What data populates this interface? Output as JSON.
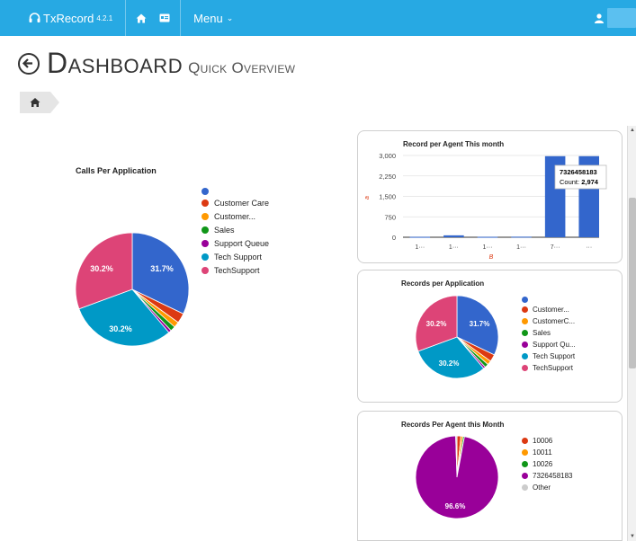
{
  "navbar": {
    "brand": "TxRecord",
    "version": "4.2.1",
    "menu_label": "Menu",
    "icons": [
      "headset-icon",
      "home-icon",
      "id-card-icon",
      "user-icon"
    ]
  },
  "page": {
    "title": "Dashboard",
    "subtitle": "Quick Overview"
  },
  "calls_per_application": {
    "title": "Calls Per Application",
    "legend": [
      {
        "label": "",
        "color": "#3366cc"
      },
      {
        "label": "Customer Care",
        "color": "#dc3912"
      },
      {
        "label": "Customer...",
        "color": "#ff9900"
      },
      {
        "label": "Sales",
        "color": "#109618"
      },
      {
        "label": "Support Queue",
        "color": "#990099"
      },
      {
        "label": "Tech Support",
        "color": "#0099c6"
      },
      {
        "label": "TechSupport",
        "color": "#dd4477"
      }
    ],
    "slice_labels": [
      "31.7%",
      "30.2%",
      "30.2%"
    ]
  },
  "record_per_agent": {
    "title": "Record per Agent This month",
    "y_ticks": [
      "0",
      "750",
      "1,500",
      "2,250",
      "3,000"
    ],
    "x_ticks": [
      "1···",
      "1···",
      "1···",
      "1···",
      "7···",
      "···"
    ],
    "y_axis_label": "a",
    "x_axis_label": "B",
    "tooltip_title": "7326458183",
    "tooltip_count_label": "Count:",
    "tooltip_count_value": "2,974"
  },
  "records_per_application": {
    "title": "Records per Application",
    "legend": [
      {
        "label": "",
        "color": "#3366cc"
      },
      {
        "label": "Customer...",
        "color": "#dc3912"
      },
      {
        "label": "CustomerC...",
        "color": "#ff9900"
      },
      {
        "label": "Sales",
        "color": "#109618"
      },
      {
        "label": "Support Qu...",
        "color": "#990099"
      },
      {
        "label": "Tech Support",
        "color": "#0099c6"
      },
      {
        "label": "TechSupport",
        "color": "#dd4477"
      }
    ],
    "slice_labels": [
      "31.7%",
      "30.2%",
      "30.2%"
    ]
  },
  "records_per_agent_month": {
    "title": "Records Per Agent this Month",
    "legend": [
      {
        "label": "10006",
        "color": "#dc3912"
      },
      {
        "label": "10011",
        "color": "#ff9900"
      },
      {
        "label": "10026",
        "color": "#109618"
      },
      {
        "label": "7326458183",
        "color": "#990099"
      },
      {
        "label": "Other",
        "color": "#cccccc"
      }
    ],
    "slice_labels": [
      "96.6%"
    ]
  },
  "chart_data": [
    {
      "type": "pie",
      "title": "Calls Per Application",
      "categories": [
        "",
        "Customer Care",
        "Customer...",
        "Sales",
        "Support Queue",
        "Tech Support",
        "TechSupport"
      ],
      "values": [
        31.7,
        2.8,
        1.6,
        1.4,
        0.8,
        30.2,
        30.2
      ],
      "colors": [
        "#3366cc",
        "#dc3912",
        "#ff9900",
        "#109618",
        "#990099",
        "#0099c6",
        "#dd4477"
      ]
    },
    {
      "type": "bar",
      "title": "Record per Agent This month",
      "categories": [
        "1···",
        "1···",
        "1···",
        "1···",
        "7···",
        "···"
      ],
      "values": [
        15,
        70,
        15,
        20,
        2974,
        2974
      ],
      "ylim": [
        0,
        3000
      ],
      "xlabel": "B",
      "ylabel": "a"
    },
    {
      "type": "pie",
      "title": "Records per Application",
      "categories": [
        "",
        "Customer...",
        "CustomerC...",
        "Sales",
        "Support Qu...",
        "Tech Support",
        "TechSupport"
      ],
      "values": [
        31.7,
        2.8,
        1.6,
        1.4,
        0.8,
        30.2,
        30.2
      ],
      "colors": [
        "#3366cc",
        "#dc3912",
        "#ff9900",
        "#109618",
        "#990099",
        "#0099c6",
        "#dd4477"
      ]
    },
    {
      "type": "pie",
      "title": "Records Per Agent this Month",
      "categories": [
        "10006",
        "10011",
        "10026",
        "7326458183",
        "Other"
      ],
      "values": [
        1.5,
        0.8,
        0.6,
        96.6,
        0.5
      ],
      "colors": [
        "#dc3912",
        "#ff9900",
        "#109618",
        "#990099",
        "#cccccc"
      ]
    }
  ]
}
